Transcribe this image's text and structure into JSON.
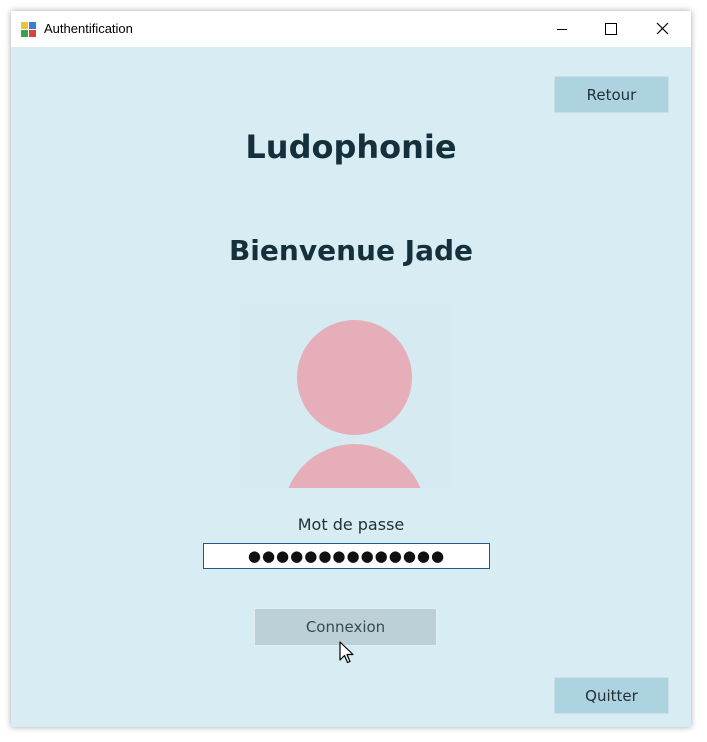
{
  "window": {
    "title": "Authentification",
    "title_icon": "app-icon",
    "controls": {
      "minimize": "minimize-icon",
      "maximize": "maximize-icon",
      "close": "close-icon"
    }
  },
  "header": {
    "app_name": "Ludophonie",
    "welcome": "Bienvenue Jade",
    "back_label": "Retour"
  },
  "avatar": {
    "icon": "user-avatar-icon",
    "color": "#e5aeb9"
  },
  "form": {
    "password_label": "Mot de passe",
    "password_value": "●●●●●●●●●●●●●●",
    "submit_label": "Connexion"
  },
  "footer": {
    "quit_label": "Quitter"
  },
  "colors": {
    "background": "#d8ecf3",
    "button": "#add3e1",
    "button_pressed": "#bcd0d7",
    "text": "#15303d"
  }
}
